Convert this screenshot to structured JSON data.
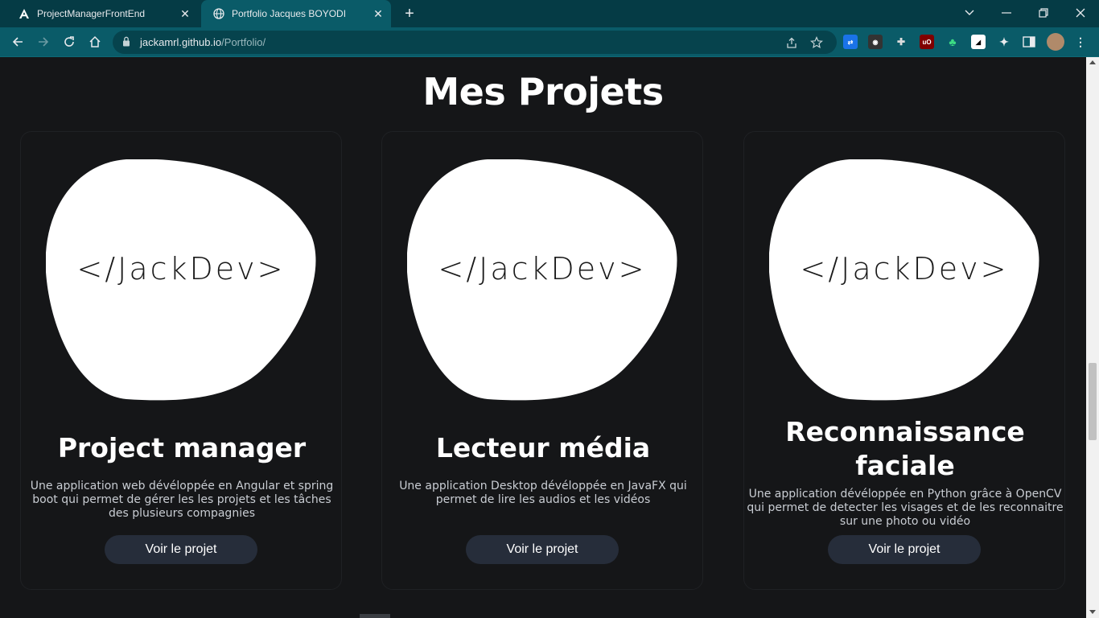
{
  "browser": {
    "tabs": [
      {
        "title": "ProjectManagerFrontEnd",
        "favicon": "angular-icon",
        "active": false
      },
      {
        "title": "Portfolio Jacques BOYODI",
        "favicon": "globe-icon",
        "active": true
      }
    ],
    "url_host": "jackamrl.github.io",
    "url_path": "/Portfolio/"
  },
  "page": {
    "section_title": "Mes Projets",
    "projects": [
      {
        "logo": "</JackDev>",
        "name": "Project manager",
        "description": "Une application web dévéloppée en Angular et spring boot qui permet de gérer les les projets et les tâches des plusieurs compagnies",
        "button": "Voir le projet"
      },
      {
        "logo": "</JackDev>",
        "name": "Lecteur média",
        "description": "Une application Desktop dévéloppée en JavaFX qui permet de lire les audios et les vidéos",
        "button": "Voir le projet"
      },
      {
        "logo": "</JackDev>",
        "name": "Reconnaissance faciale",
        "description": "Une application dévéloppée en Python grâce à OpenCV qui permet de detecter les visages et de les reconnaitre sur une photo ou vidéo",
        "button": "Voir le projet"
      }
    ]
  },
  "colors": {
    "tabstrip": "#053b45",
    "toolbar": "#0a5b68",
    "page_bg": "#151618",
    "button_bg": "#262d3a"
  }
}
